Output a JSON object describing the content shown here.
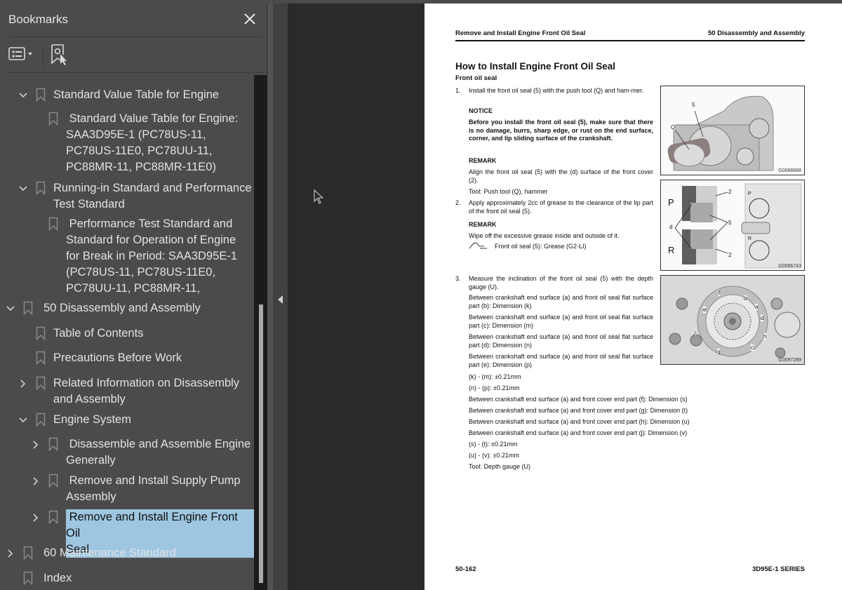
{
  "bookmarks_panel": {
    "title": "Bookmarks",
    "close_icon": "close-icon",
    "options_icon": "list-options-icon",
    "find_bookmark_icon": "find-current-bookmark-icon",
    "items": [
      {
        "label": "Standard Value Table for Engine",
        "level": 1,
        "toggle": "expanded"
      },
      {
        "label": " Standard Value Table for Engine:\nSAA3D95E-1 (PC78US-11,\nPC78US-11E0, PC78UU-11,\nPC88MR-11, PC88MR-11E0)",
        "level": 2,
        "toggle": "none"
      },
      {
        "label": "Running-in Standard and Performance\nTest Standard",
        "level": 1,
        "toggle": "expanded"
      },
      {
        "label": " Performance Test Standard and\nStandard for Operation of Engine\nfor Break in Period: SAA3D95E-1\n(PC78US-11, PC78US-11E0,\nPC78UU-11, PC88MR-11,",
        "level": 2,
        "toggle": "none"
      },
      {
        "label": "50 Disassembly and Assembly",
        "level": 0,
        "toggle": "expanded"
      },
      {
        "label": "Table of Contents",
        "level": 1,
        "toggle": "none"
      },
      {
        "label": "Precautions Before Work",
        "level": 1,
        "toggle": "none"
      },
      {
        "label": "Related Information on Disassembly\nand Assembly",
        "level": 1,
        "toggle": "collapsed"
      },
      {
        "label": "Engine System",
        "level": 1,
        "toggle": "expanded"
      },
      {
        "label": " Disassemble and Assemble Engine\nGenerally",
        "level": 2,
        "toggle": "collapsed"
      },
      {
        "label": " Remove and Install Supply Pump\nAssembly",
        "level": 2,
        "toggle": "collapsed"
      },
      {
        "label": " Remove and Install Engine Front Oil\nSeal",
        "level": 2,
        "toggle": "collapsed",
        "selected": true
      },
      {
        "label": "60 Maintenance Standard",
        "level": 0,
        "toggle": "collapsed"
      },
      {
        "label": "Index",
        "level": 0,
        "toggle": "none"
      }
    ],
    "selection_color": "#9ec6e0"
  },
  "document_page": {
    "header_left": "Remove and Install Engine Front Oil Seal",
    "header_right": "50 Disassembly and Assembly",
    "title": "How to Install Engine Front Oil Seal",
    "subtitle": "Front oil seal",
    "step1": {
      "number": "1.",
      "text": "Install the front oil seal (5) with the push tool (Q) and ham-mer.",
      "notice_label": "NOTICE",
      "notice_text": "Before you install the front oil seal (5), make sure that there is no damage, burrs, sharp edge, or rust on the end surface, corner, and lip sliding surface of the crankshaft.",
      "remark_label": "REMARK",
      "remark_text": "Align the front oil seal (5) with the (d) surface of the front cover (2).",
      "tool": "Tool: Push tool (Q), hammer"
    },
    "step2": {
      "number": "2.",
      "text": "Apply approximately 2cc of grease to the clearance of the lip part of the front oil seal (5).",
      "remark_label": "REMARK",
      "remark_text": "Wipe off the excessive grease inside and outside of it.",
      "grease_icon": "grease-gun-icon",
      "grease_text": "Front oil seal (5): Grease (G2-LI)"
    },
    "step3": {
      "number": "3.",
      "text": "Measure the inclination of the front oil seal (5) with the depth gauge (U).",
      "lines": [
        "Between crankshaft end surface (a) and front oil seal flat surface part (b): Dimension (k)",
        "Between crankshaft end surface (a) and front oil seal flat surface part (c): Dimension (m)",
        "Between crankshaft end surface (a) and front oil seal flat surface part (d): Dimension (n)",
        "Between crankshaft end surface (a) and front oil seal flat surface part (e): Dimension (p)"
      ],
      "after_lines": [
        "(k) - (m): ±0.21mm",
        "(n) - (p): ±0.21mm",
        "Between crankshaft end surface (a) and front cover end part (f): Dimension (s)",
        "Between crankshaft end surface (a) and front cover end part (g): Dimension (t)",
        "Between crankshaft end surface (a) and front cover end part (h): Dimension (u)",
        "Between crankshaft end surface (a) and front cover end part (j): Dimension (v)",
        "(s) - (t): ±0.21mm",
        "(u) - (v): ±0.21mm",
        "Tool: Depth gauge (U)"
      ]
    },
    "figures": [
      {
        "code": "G0088668",
        "labels": [
          "5",
          "Q"
        ]
      },
      {
        "code": "G0096743",
        "labels": [
          "P",
          "R",
          "2",
          "2",
          "d",
          "5",
          "P",
          "R"
        ]
      },
      {
        "code": "G0097289",
        "labels": [
          "f",
          "b",
          "a",
          "e",
          "d",
          "j",
          "h",
          "g",
          "c"
        ]
      }
    ],
    "footer_left": "50-162",
    "footer_right": "3D95E-1 SERIES"
  }
}
